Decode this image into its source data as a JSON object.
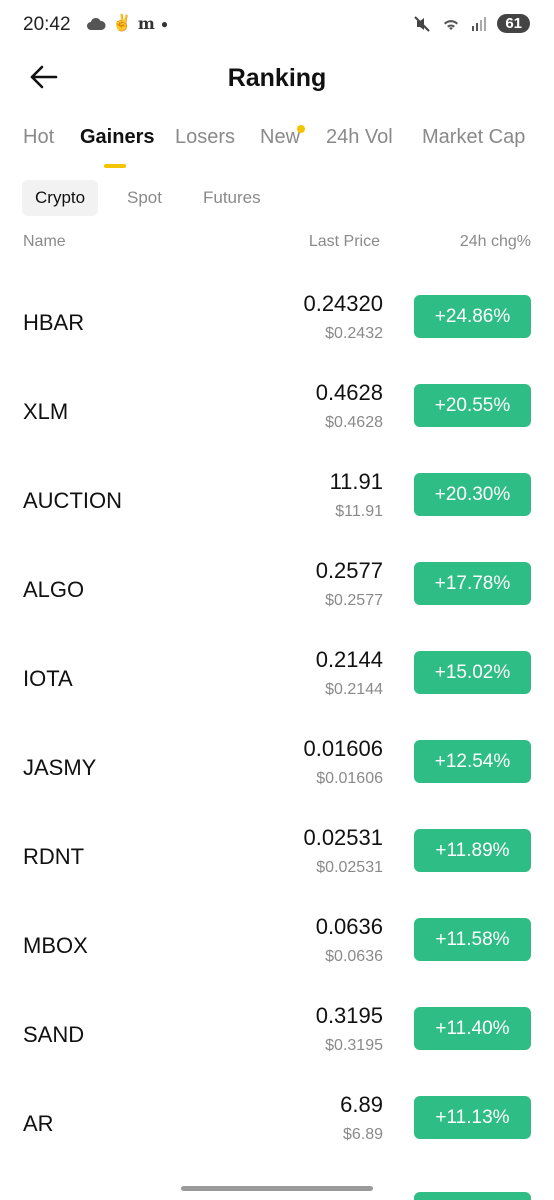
{
  "status": {
    "time": "20:42",
    "battery": "61"
  },
  "header": {
    "title": "Ranking"
  },
  "tabs": [
    "Hot",
    "Gainers",
    "Losers",
    "New",
    "24h Vol",
    "Market Cap"
  ],
  "subtabs": [
    "Crypto",
    "Spot",
    "Futures"
  ],
  "columns": {
    "name": "Name",
    "price": "Last Price",
    "change": "24h chg%"
  },
  "rows": [
    {
      "symbol": "HBAR",
      "price": "0.24320",
      "usd": "$0.2432",
      "change": "+24.86%"
    },
    {
      "symbol": "XLM",
      "price": "0.4628",
      "usd": "$0.4628",
      "change": "+20.55%"
    },
    {
      "symbol": "AUCTION",
      "price": "11.91",
      "usd": "$11.91",
      "change": "+20.30%"
    },
    {
      "symbol": "ALGO",
      "price": "0.2577",
      "usd": "$0.2577",
      "change": "+17.78%"
    },
    {
      "symbol": "IOTA",
      "price": "0.2144",
      "usd": "$0.2144",
      "change": "+15.02%"
    },
    {
      "symbol": "JASMY",
      "price": "0.01606",
      "usd": "$0.01606",
      "change": "+12.54%"
    },
    {
      "symbol": "RDNT",
      "price": "0.02531",
      "usd": "$0.02531",
      "change": "+11.89%"
    },
    {
      "symbol": "MBOX",
      "price": "0.0636",
      "usd": "$0.0636",
      "change": "+11.58%"
    },
    {
      "symbol": "SAND",
      "price": "0.3195",
      "usd": "$0.3195",
      "change": "+11.40%"
    },
    {
      "symbol": "AR",
      "price": "6.89",
      "usd": "$6.89",
      "change": "+11.13%"
    }
  ]
}
